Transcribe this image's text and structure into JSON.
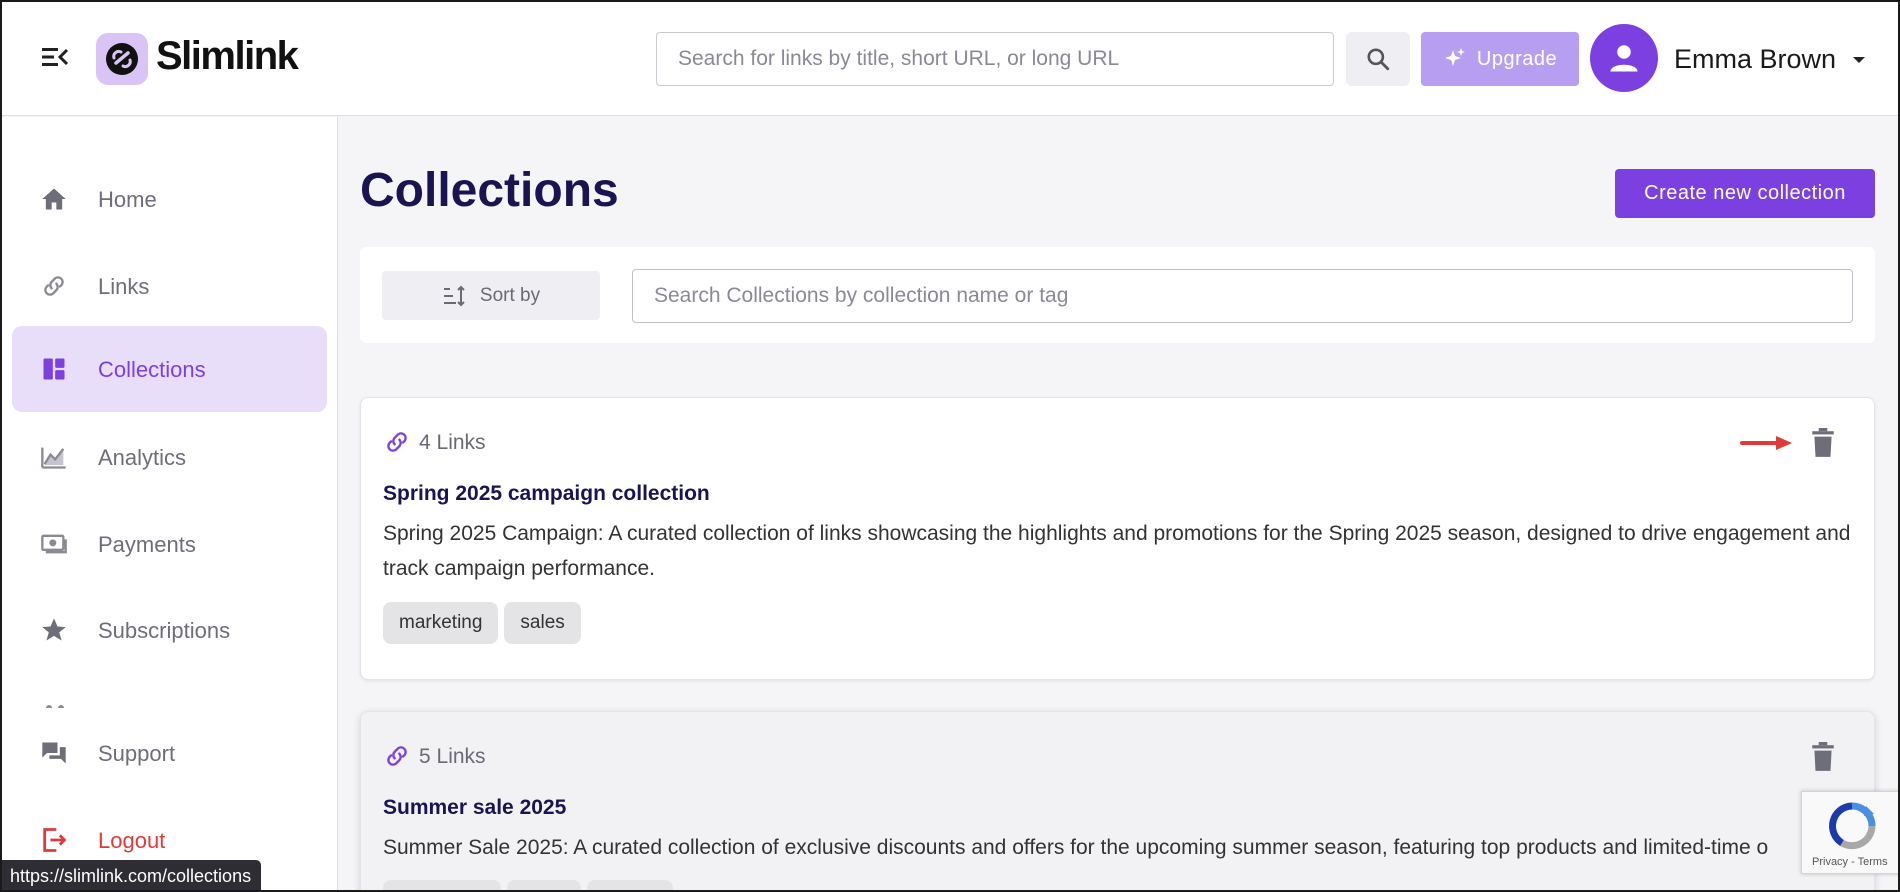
{
  "app": {
    "name": "Slimlink",
    "brand_color": "#7c3fe0"
  },
  "header": {
    "search_placeholder": "Search for links by title, short URL, or long URL",
    "upgrade_label": "Upgrade",
    "user_name": "Emma Brown"
  },
  "sidebar": {
    "items": [
      {
        "label": "Home",
        "icon": "home-icon"
      },
      {
        "label": "Links",
        "icon": "link-icon"
      },
      {
        "label": "Collections",
        "icon": "collections-icon",
        "active": true
      },
      {
        "label": "Analytics",
        "icon": "analytics-icon"
      },
      {
        "label": "Payments",
        "icon": "payments-icon"
      },
      {
        "label": "Subscriptions",
        "icon": "star-icon"
      },
      {
        "label": "Support",
        "icon": "chat-icon"
      },
      {
        "label": "Logout",
        "icon": "logout-icon"
      }
    ]
  },
  "main": {
    "title": "Collections",
    "create_label": "Create new collection",
    "sort_label": "Sort by",
    "search_placeholder": "Search Collections by collection name or tag",
    "collections": [
      {
        "link_count": "4 Links",
        "title": "Spring 2025 campaign collection",
        "description": "Spring 2025 Campaign: A curated collection of links showcasing the highlights and promotions for the Spring 2025 season, designed to drive engagement and track campaign performance.",
        "tags": [
          "marketing",
          "sales"
        ]
      },
      {
        "link_count": "5 Links",
        "title": "Summer sale 2025",
        "description": "Summer Sale 2025: A curated collection of exclusive discounts and offers for the upcoming summer season, featuring top products and limited-time o"
      }
    ]
  },
  "status_bar": {
    "url": "https://slimlink.com/collections"
  },
  "recaptcha": {
    "text": "Privacy - Terms"
  }
}
